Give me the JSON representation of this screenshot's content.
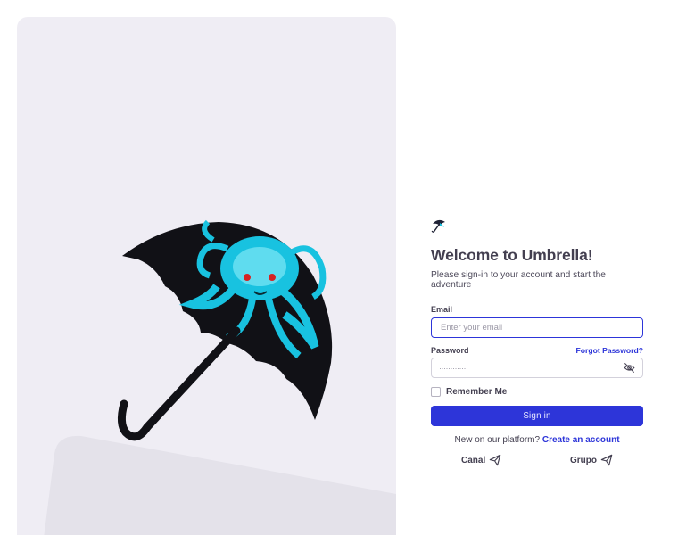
{
  "brand": {
    "logo_icon": "umbrella-icon",
    "accent": "#2d35d9"
  },
  "heading": {
    "title": "Welcome to Umbrella!",
    "subtitle": "Please sign-in to your account and start the adventure"
  },
  "form": {
    "email_label": "Email",
    "email_placeholder": "Enter your email",
    "password_label": "Password",
    "forgot_label": "Forgot Password?",
    "password_mask": "············",
    "remember_label": "Remember Me",
    "remember_checked": false,
    "signin_label": "Sign in"
  },
  "footer": {
    "new_text": "New on our platform?",
    "create_label": "Create an account"
  },
  "social": [
    {
      "label": "Canal",
      "icon": "send-icon"
    },
    {
      "label": "Grupo",
      "icon": "send-icon"
    }
  ]
}
